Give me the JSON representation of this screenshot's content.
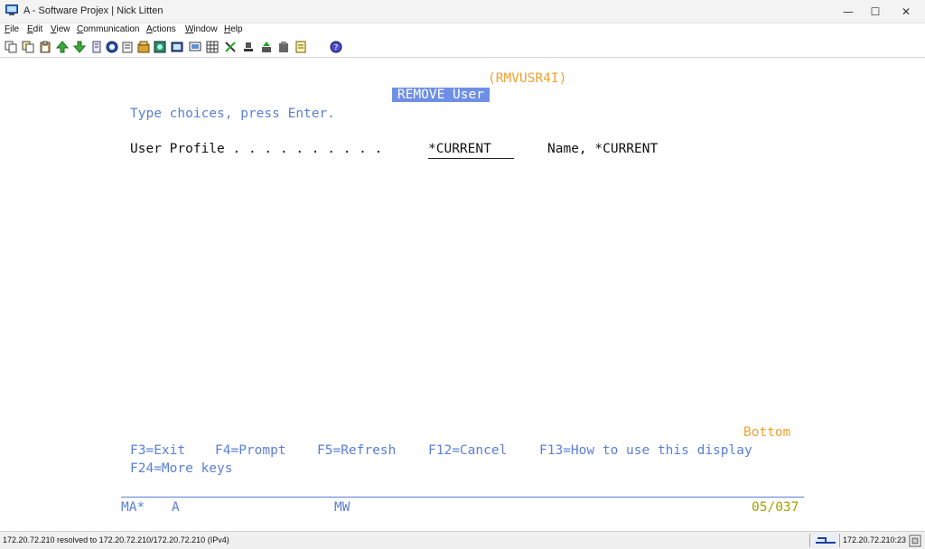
{
  "window": {
    "title": "A - Software Projex | Nick Litten",
    "minimize_glyph": "—",
    "maximize_glyph": "☐",
    "close_glyph": "✕"
  },
  "menu": [
    {
      "underlined": "F",
      "rest": "ile"
    },
    {
      "underlined": "E",
      "rest": "dit"
    },
    {
      "underlined": "V",
      "rest": "iew"
    },
    {
      "underlined": "C",
      "rest": "ommunication"
    },
    {
      "underlined": "A",
      "rest": "ctions"
    },
    {
      "underlined": "W",
      "rest": "indow"
    },
    {
      "underlined": "H",
      "rest": "elp"
    }
  ],
  "toolbar_icons": [
    "copy-icon",
    "copy-append-icon",
    "paste-icon",
    "send-file-icon",
    "receive-file-icon",
    "print-icon",
    "navigator-icon",
    "clipboard-icon",
    "macro-icon",
    "record-icon",
    "keyboard-map-icon",
    "display-icon",
    "settings-icon",
    "play-macro-icon",
    "stop-icon",
    "transfer-icon",
    "session-icon",
    "notes-icon",
    "help-icon"
  ],
  "screen": {
    "title": "REMOVE User",
    "command": "(RMVUSR4I)",
    "instructions": "Type choices, press Enter.",
    "field_label": "User Profile . . . . . . . . . .",
    "field_value": "*CURRENT",
    "field_hint": "Name, *CURRENT",
    "more_indicator": "Bottom",
    "fkeys": [
      "F3=Exit",
      "F4=Prompt",
      "F5=Refresh",
      "F12=Cancel",
      "F13=How to use this display"
    ],
    "fkeys_line2": "F24=More keys"
  },
  "oia": {
    "mode": "MA*",
    "session": "A",
    "workstation": "MW",
    "cursor_position": "05/037"
  },
  "statusbar": {
    "message": "172.20.72.210 resolved to 172.20.72.210/172.20.72.210 (IPv4)",
    "host": "172.20.72.210:23"
  },
  "colors": {
    "field_text": "#5a7fd6",
    "highlight_bg": "#6f8fe6",
    "accent_orange": "#f0a030",
    "cursor_position_color": "#a6a000"
  }
}
